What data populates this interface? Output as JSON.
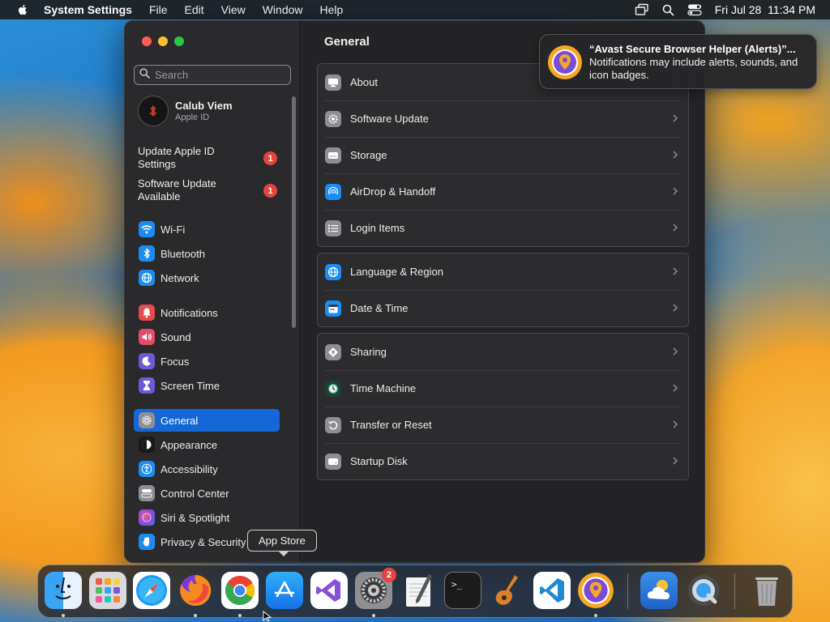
{
  "menubar": {
    "app_name": "System Settings",
    "menus": [
      "File",
      "Edit",
      "View",
      "Window",
      "Help"
    ],
    "clock": "Fri Jul 28  11:34 PM"
  },
  "sidebar": {
    "search_placeholder": "Search",
    "profile": {
      "name": "Calub Viem",
      "subtitle": "Apple ID"
    },
    "alerts": [
      {
        "label": "Update Apple ID Settings",
        "badge": "1"
      },
      {
        "label": "Software Update Available",
        "badge": "1"
      }
    ],
    "items": [
      {
        "label": "Wi-Fi",
        "icon": "wifi-icon",
        "color": "#1c8cf2"
      },
      {
        "label": "Bluetooth",
        "icon": "bluetooth-icon",
        "color": "#1c8cf2"
      },
      {
        "label": "Network",
        "icon": "globe-icon",
        "color": "#1c8cf2"
      },
      {
        "label": "Notifications",
        "icon": "bell-icon",
        "color": "#e84b4b"
      },
      {
        "label": "Sound",
        "icon": "speaker-icon",
        "color": "#e84b6a"
      },
      {
        "label": "Focus",
        "icon": "moon-icon",
        "color": "#6b5bd6"
      },
      {
        "label": "Screen Time",
        "icon": "hourglass-icon",
        "color": "#6b5bd6"
      },
      {
        "label": "General",
        "icon": "gear-icon",
        "color": "#8e8e93",
        "selected": true
      },
      {
        "label": "Appearance",
        "icon": "appearance-icon",
        "color": "#1a1a1a"
      },
      {
        "label": "Accessibility",
        "icon": "accessibility-icon",
        "color": "#1c8cf2"
      },
      {
        "label": "Control Center",
        "icon": "control-center-icon",
        "color": "#8e8e93"
      },
      {
        "label": "Siri & Spotlight",
        "icon": "siri-icon",
        "color": "#b05ad8"
      },
      {
        "label": "Privacy & Security",
        "icon": "hand-icon",
        "color": "#1c8cf2"
      }
    ]
  },
  "main": {
    "title": "General",
    "groups": [
      [
        {
          "label": "About",
          "icon": "display-icon",
          "color": "#8e8e93"
        },
        {
          "label": "Software Update",
          "icon": "gear-badge-icon",
          "color": "#8e8e93"
        },
        {
          "label": "Storage",
          "icon": "storage-icon",
          "color": "#8e8e93"
        },
        {
          "label": "AirDrop & Handoff",
          "icon": "airdrop-icon",
          "color": "#1c8cf2"
        },
        {
          "label": "Login Items",
          "icon": "list-icon",
          "color": "#8e8e93"
        }
      ],
      [
        {
          "label": "Language & Region",
          "icon": "globe-icon",
          "color": "#1c8cf2"
        },
        {
          "label": "Date & Time",
          "icon": "calendar-icon",
          "color": "#1c8cf2"
        }
      ],
      [
        {
          "label": "Sharing",
          "icon": "sharing-icon",
          "color": "#8e8e93"
        },
        {
          "label": "Time Machine",
          "icon": "time-machine-icon",
          "color": "#1f3f36"
        },
        {
          "label": "Transfer or Reset",
          "icon": "reset-icon",
          "color": "#8e8e93"
        },
        {
          "label": "Startup Disk",
          "icon": "disk-icon",
          "color": "#8e8e93"
        }
      ]
    ]
  },
  "notification": {
    "title": "“Avast Secure Browser Helper (Alerts)”...",
    "body": "Notifications may include alerts, sounds, and icon badges.",
    "icon": "avast-browser-icon"
  },
  "tooltip": {
    "text": "App Store"
  },
  "dock": {
    "apps": [
      {
        "name": "Finder",
        "icon": "finder-icon",
        "running": true
      },
      {
        "name": "Launchpad",
        "icon": "launchpad-icon",
        "running": false
      },
      {
        "name": "Safari",
        "icon": "safari-icon",
        "running": false
      },
      {
        "name": "Firefox",
        "icon": "firefox-icon",
        "running": true
      },
      {
        "name": "Google Chrome",
        "icon": "chrome-icon",
        "running": true
      },
      {
        "name": "App Store",
        "icon": "app-store-icon",
        "running": false
      },
      {
        "name": "Visual Studio",
        "icon": "visual-studio-icon",
        "running": false
      },
      {
        "name": "System Settings",
        "icon": "system-settings-icon",
        "running": true,
        "badge": "2"
      },
      {
        "name": "TextEdit",
        "icon": "textedit-icon",
        "running": false
      },
      {
        "name": "Terminal",
        "icon": "terminal-icon",
        "running": false
      },
      {
        "name": "GarageBand",
        "icon": "garageband-icon",
        "running": false
      },
      {
        "name": "Visual Studio Code",
        "icon": "vscode-icon",
        "running": false
      },
      {
        "name": "Avast Secure Browser",
        "icon": "avast-browser-icon",
        "running": true
      },
      {
        "name": "Weather",
        "icon": "weather-icon",
        "running": false
      },
      {
        "name": "QuickTime Player",
        "icon": "quicktime-icon",
        "running": false
      },
      {
        "name": "Trash",
        "icon": "trash-icon",
        "running": false
      }
    ]
  }
}
